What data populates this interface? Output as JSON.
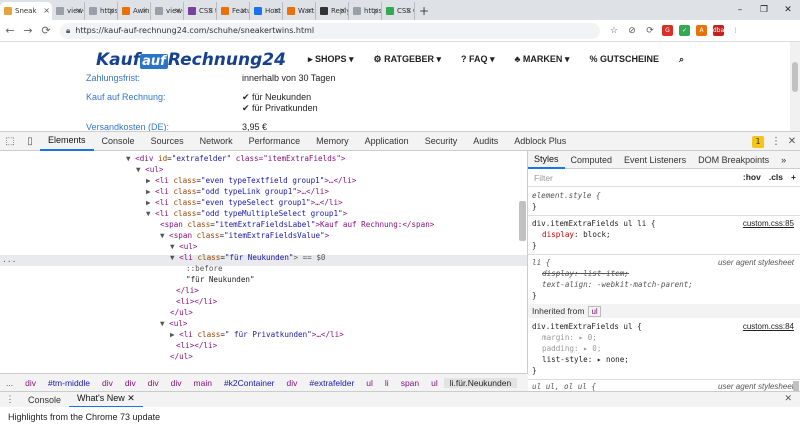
{
  "browser": {
    "tabs": [
      {
        "label": "Sneak",
        "color": "#e8a33d"
      },
      {
        "label": "view-",
        "color": "#9aa0a6"
      },
      {
        "label": "https",
        "color": "#9aa0a6"
      },
      {
        "label": "Awin",
        "color": "#e8710a"
      },
      {
        "label": "view-",
        "color": "#9aa0a6"
      },
      {
        "label": "CSS t",
        "color": "#7b3f9e"
      },
      {
        "label": "Featu",
        "color": "#e8710a"
      },
      {
        "label": "Host",
        "color": "#1a73e8"
      },
      {
        "label": "Warti",
        "color": "#e8710a"
      },
      {
        "label": "Reply",
        "color": "#333333"
      },
      {
        "label": "https",
        "color": "#9aa0a6"
      },
      {
        "label": "CSS C",
        "color": "#34a853"
      }
    ],
    "new_tab": "+",
    "window_controls": [
      "–",
      "❐",
      "✕"
    ],
    "url": "https://kauf-auf-rechnung24.com/schuhe/sneakertwins.html",
    "toolbar_icons": [
      "☆",
      "⊘",
      "⟳"
    ],
    "extensions": [
      {
        "label": "G",
        "color": "#d93025"
      },
      {
        "label": "✓",
        "color": "#34a853"
      },
      {
        "label": "A",
        "color": "#e8710a"
      },
      {
        "label": "dba",
        "color": "#c5221f"
      },
      {
        "label": "⋮",
        "color": "#ffffff"
      }
    ]
  },
  "site": {
    "logo_text": "Kauf",
    "logo_auf": "auf",
    "logo_rest": "Rechnung24",
    "nav": [
      "▸ SHOPS ▾",
      "⚙ RATGEBER ▾",
      "? FAQ ▾",
      "♣ MARKEN ▾",
      "% GUTSCHEINE",
      "⌕"
    ],
    "rows": [
      {
        "label": "Zahlungsfrist:",
        "value": "innerhalb von 30 Tagen"
      },
      {
        "label": "Kauf auf Rechnung:",
        "value": "✔ für Neukunden"
      },
      {
        "label": "",
        "value": "✔ für Privatkunden"
      },
      {
        "label": "Versandkosten (DE):",
        "value": "3,95 €"
      }
    ]
  },
  "devtools": {
    "tabs": [
      "Elements",
      "Console",
      "Sources",
      "Network",
      "Performance",
      "Memory",
      "Application",
      "Security",
      "Audits",
      "Adblock Plus"
    ],
    "warning_count": "1",
    "element_lines": [
      {
        "indent": 126,
        "arrow": "▼",
        "t": "<div ",
        "a": "id",
        "v": "\"extrafelder\"",
        "rest": " class=\"itemExtraFields\">"
      },
      {
        "indent": 136,
        "arrow": "▼",
        "t": "<ul>",
        "a": "",
        "v": "",
        "rest": ""
      },
      {
        "indent": 146,
        "arrow": "▶",
        "t": "<li ",
        "a": "class",
        "v": "\"even typeTextfield group1\"",
        "rest": ">…</li>"
      },
      {
        "indent": 146,
        "arrow": "▶",
        "t": "<li ",
        "a": "class",
        "v": "\"odd typeLink group1\"",
        "rest": ">…</li>"
      },
      {
        "indent": 146,
        "arrow": "▶",
        "t": "<li ",
        "a": "class",
        "v": "\"even typeSelect group1\"",
        "rest": ">…</li>"
      },
      {
        "indent": 146,
        "arrow": "▼",
        "t": "<li ",
        "a": "class",
        "v": "\"odd typeMultipleSelect group1\"",
        "rest": ">"
      },
      {
        "indent": 160,
        "arrow": "",
        "t": "<span ",
        "a": "class",
        "v": "\"itemExtraFieldsLabel\"",
        "rest": ">Kauf auf Rechnung:</span>"
      },
      {
        "indent": 160,
        "arrow": "▼",
        "t": "<span ",
        "a": "class",
        "v": "\"itemExtraFieldsValue\"",
        "rest": ">"
      },
      {
        "indent": 170,
        "arrow": "▼",
        "t": "<ul>",
        "a": "",
        "v": "",
        "rest": ""
      },
      {
        "indent": 170,
        "arrow": "▼",
        "t": "<li ",
        "a": "class",
        "v": "\"für Neukunden\"",
        "rest": "> == $0"
      },
      {
        "indent": 186,
        "arrow": "",
        "t": "::before",
        "a": "",
        "v": "",
        "rest": ""
      },
      {
        "indent": 186,
        "arrow": "",
        "t": "\"für Neukunden\"",
        "a": "",
        "v": "",
        "rest": ""
      },
      {
        "indent": 176,
        "arrow": "",
        "t": "</li>",
        "a": "",
        "v": "",
        "rest": ""
      },
      {
        "indent": 176,
        "arrow": "",
        "t": "<li></li>",
        "a": "",
        "v": "",
        "rest": ""
      },
      {
        "indent": 170,
        "arrow": "",
        "t": "</ul>",
        "a": "",
        "v": "",
        "rest": ""
      },
      {
        "indent": 160,
        "arrow": "▼",
        "t": "<ul>",
        "a": "",
        "v": "",
        "rest": ""
      },
      {
        "indent": 170,
        "arrow": "▶",
        "t": "<li ",
        "a": "class",
        "v": "\" für Privatkunden\"",
        "rest": ">…</li>"
      },
      {
        "indent": 176,
        "arrow": "",
        "t": "<li></li>",
        "a": "",
        "v": "",
        "rest": ""
      },
      {
        "indent": 170,
        "arrow": "",
        "t": "</ul>",
        "a": "",
        "v": "",
        "rest": ""
      }
    ],
    "gutter_dots": "...",
    "breadcrumbs": [
      "...",
      "div",
      "#tm-middle",
      "div",
      "div",
      "div",
      "div",
      "main",
      "#k2Container",
      "div",
      "#extrafelder",
      "ul",
      "li",
      "span",
      "ul",
      "li.für.Neukunden"
    ],
    "styles_tabs": [
      "Styles",
      "Computed",
      "Event Listeners",
      "DOM Breakpoints",
      "»"
    ],
    "filter_placeholder": "Filter",
    "filter_hov": ":hov",
    "filter_cls": ".cls",
    "filter_add": "+",
    "rules": {
      "element_style_open": "element.style {",
      "element_style_close": "}",
      "r1_selector": "div.itemExtraFields ul li {",
      "r1_source": "custom.css:85",
      "r1_prop": "display",
      "r1_value": "block;",
      "r1_close": "}",
      "r2_selector": "li {",
      "r2_source": "user agent stylesheet",
      "r2_prop1": "display: list-item;",
      "r2_prop2": "text-align: -webkit-match-parent;",
      "r2_close": "}",
      "inherited_label": "Inherited from",
      "inherited_tag": "ul",
      "r3_selector": "div.itemExtraFields ul {",
      "r3_source": "custom.css:84",
      "r3_prop1": "margin: ▸ 0;",
      "r3_prop2": "padding: ▸ 0;",
      "r3_prop3": "list-style",
      "r3_value3": "▸ none;",
      "r3_close": "}",
      "r4_selector": "ul ul, ol ul {",
      "r4_source": "user agent stylesheet"
    },
    "drawer_tabs": [
      "Console",
      "What's New ✕"
    ],
    "drawer_close": "✕",
    "highlights_text": "Highlights from the Chrome 73 update"
  }
}
